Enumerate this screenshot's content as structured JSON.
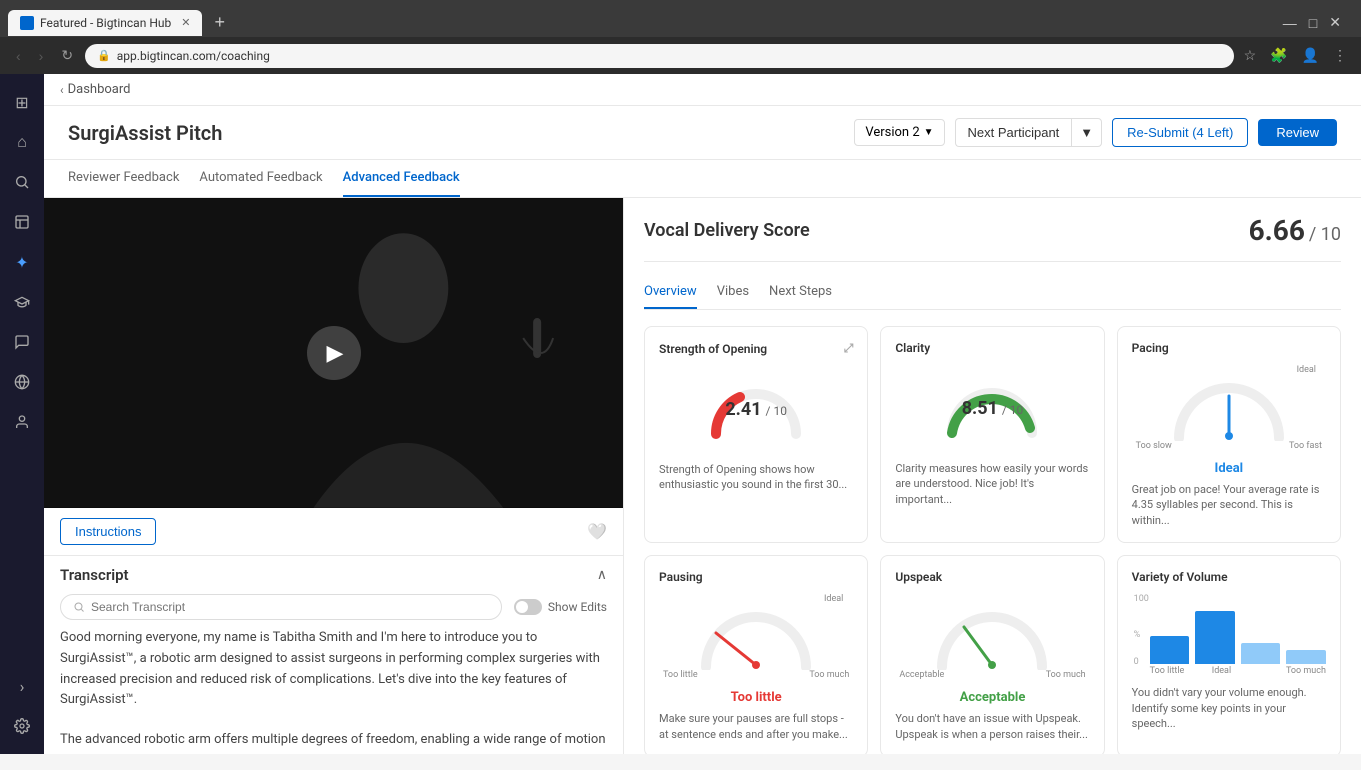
{
  "browser": {
    "tab_title": "Featured - Bigtincan Hub",
    "url": "app.bigtincan.com/coaching"
  },
  "breadcrumb": {
    "back_label": "Dashboard"
  },
  "page": {
    "title": "SurgiAssist Pitch",
    "version": "Version 2",
    "btn_next_participant": "Next Participant",
    "btn_resubmit": "Re-Submit (4 Left)",
    "btn_review": "Review"
  },
  "tabs": [
    {
      "label": "Reviewer Feedback",
      "active": false
    },
    {
      "label": "Automated Feedback",
      "active": false
    },
    {
      "label": "Advanced Feedback",
      "active": true
    }
  ],
  "score_panel": {
    "title": "Vocal Delivery Score",
    "score": "6.66",
    "denom": "/ 10",
    "tabs": [
      {
        "label": "Overview",
        "active": true
      },
      {
        "label": "Vibes",
        "active": false
      },
      {
        "label": "Next Steps",
        "active": false
      }
    ],
    "metrics": [
      {
        "id": "opening",
        "title": "Strength of Opening",
        "score": "2.41",
        "denom": "/ 10",
        "status": "",
        "status_class": "",
        "desc": "Strength of Opening shows how enthusiastic you sound in the first 30...",
        "gauge_type": "semi",
        "gauge_color": "#e53935",
        "gauge_value": 0.24
      },
      {
        "id": "clarity",
        "title": "Clarity",
        "score": "8.51",
        "denom": "/ 10",
        "status": "",
        "status_class": "",
        "desc": "Clarity measures how easily your words are understood. Nice job! It's important...",
        "gauge_type": "semi",
        "gauge_color": "#43a047",
        "gauge_value": 0.85
      },
      {
        "id": "pacing",
        "title": "Pacing",
        "score": "",
        "denom": "",
        "status": "Ideal",
        "status_class": "status-blue",
        "desc": "Great job on pace! Your average rate is 4.35 syllables per second. This is within...",
        "gauge_type": "pacing",
        "gauge_color": "#1e88e5",
        "gauge_value": 0.5
      },
      {
        "id": "pausing",
        "title": "Pausing",
        "score": "",
        "denom": "",
        "status": "Too little",
        "status_class": "status-red",
        "desc": "Make sure your pauses are full stops - at sentence ends and after you make...",
        "gauge_type": "pacing",
        "gauge_color": "#e53935",
        "gauge_value": 0.15
      },
      {
        "id": "upspeak",
        "title": "Upspeak",
        "score": "",
        "denom": "",
        "status": "Acceptable",
        "status_class": "status-green",
        "desc": "You don't have an issue with Upspeak. Upspeak is when a person raises their...",
        "gauge_type": "pacing",
        "gauge_color": "#43a047",
        "gauge_value": 0.35
      },
      {
        "id": "volume",
        "title": "Variety of Volume",
        "score": "",
        "denom": "",
        "status": "",
        "status_class": "",
        "desc": "You didn't vary your volume enough. Identify some key points in your speech...",
        "gauge_type": "bar",
        "bars": [
          40,
          75,
          30,
          20
        ],
        "bar_labels": [
          "Too little",
          "Ideal",
          "",
          "Too much"
        ]
      }
    ]
  },
  "video": {
    "play_label": "▶"
  },
  "instructions_btn": "Instructions",
  "transcript": {
    "title": "Transcript",
    "search_placeholder": "Search Transcript",
    "show_edits_label": "Show Edits",
    "text_1": "Good morning everyone, my name is Tabitha Smith and I'm here to introduce you to SurgiAssist™, a robotic arm designed to assist surgeons in performing complex surgeries with increased precision and reduced risk of complications. Let's dive into the key features of SurgiAssist™.",
    "text_2": "The advanced robotic arm offers multiple degrees of freedom, enabling a wide range of motion and precise control during"
  },
  "sidebar": {
    "icons": [
      {
        "id": "grid",
        "symbol": "⊞",
        "active": false
      },
      {
        "id": "home",
        "symbol": "⌂",
        "active": false
      },
      {
        "id": "search",
        "symbol": "🔍",
        "active": false
      },
      {
        "id": "files",
        "symbol": "📁",
        "active": false
      },
      {
        "id": "star",
        "symbol": "✦",
        "active": true
      },
      {
        "id": "grad",
        "symbol": "🎓",
        "active": false
      },
      {
        "id": "chat",
        "symbol": "💬",
        "active": false
      },
      {
        "id": "globe",
        "symbol": "🌐",
        "active": false
      },
      {
        "id": "person",
        "symbol": "👤",
        "active": false
      },
      {
        "id": "arrow",
        "symbol": "›",
        "active": false
      },
      {
        "id": "settings",
        "symbol": "⚙",
        "active": false
      }
    ]
  }
}
